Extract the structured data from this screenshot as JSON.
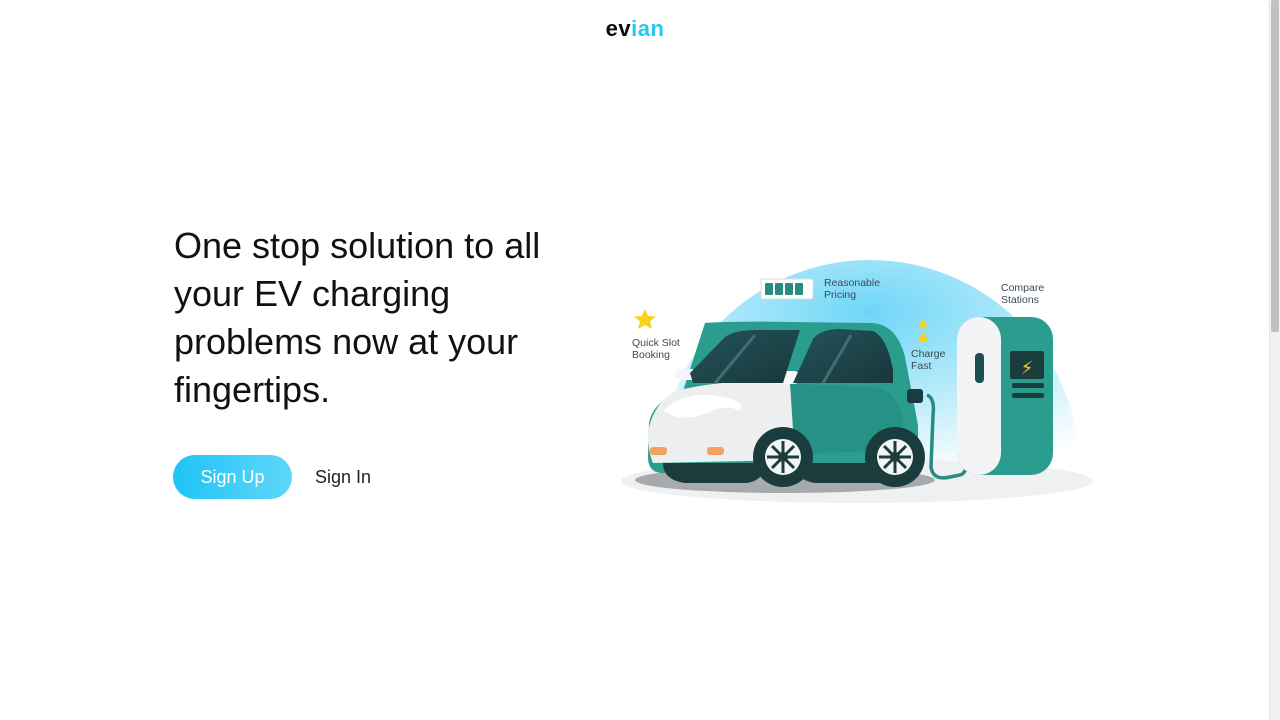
{
  "brand": {
    "part1": "ev",
    "part2": "ian"
  },
  "hero": {
    "headline": "One stop solution to all your EV charging problems now at your fingertips.",
    "signup_label": "Sign Up",
    "signin_label": "Sign In"
  },
  "illustration": {
    "features": {
      "quick_slot": [
        "Quick Slot",
        "Booking"
      ],
      "pricing": [
        "Reasonable",
        "Pricing"
      ],
      "charge_fast": [
        "Charge",
        "Fast"
      ],
      "compare": [
        "Compare",
        "Stations"
      ]
    },
    "charge_symbol": "⚡"
  },
  "colors": {
    "accent": "#28c9f0",
    "button_start": "#1fc4f6",
    "button_end": "#5fd6fa",
    "car_teal": "#2a9d8f",
    "car_dark": "#1b3c3c",
    "star": "#f5d31d"
  }
}
